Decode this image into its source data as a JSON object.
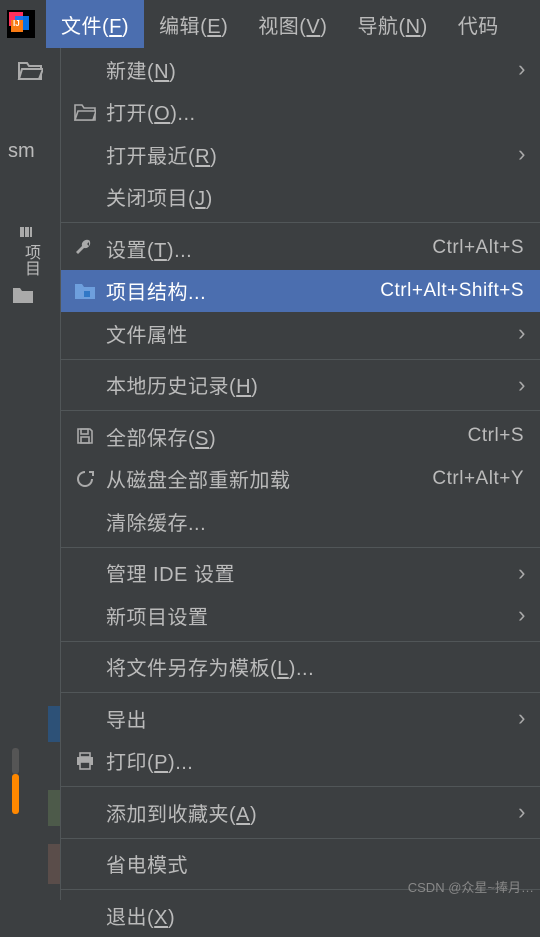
{
  "menubar": {
    "items": [
      {
        "label": "文件",
        "key": "F",
        "active": true
      },
      {
        "label": "编辑",
        "key": "E"
      },
      {
        "label": "视图",
        "key": "V"
      },
      {
        "label": "导航",
        "key": "N"
      },
      {
        "label": "代码",
        "key": ""
      }
    ]
  },
  "sidebar": {
    "proj_prefix": "sm",
    "vertical_label": "项目"
  },
  "menu": {
    "new": "新建",
    "new_key": "N",
    "open": "打开",
    "open_key": "O",
    "open_suffix": "...",
    "open_recent": "打开最近",
    "open_recent_key": "R",
    "close_project": "关闭项目",
    "close_project_key": "J",
    "settings": "设置",
    "settings_key": "T",
    "settings_suffix": "...",
    "settings_shortcut": "Ctrl+Alt+S",
    "project_structure": "项目结构...",
    "project_structure_shortcut": "Ctrl+Alt+Shift+S",
    "file_properties": "文件属性",
    "local_history": "本地历史记录",
    "local_history_key": "H",
    "save_all": "全部保存",
    "save_all_key": "S",
    "save_all_shortcut": "Ctrl+S",
    "reload_from_disk": "从磁盘全部重新加载",
    "reload_shortcut": "Ctrl+Alt+Y",
    "invalidate_caches": "清除缓存...",
    "manage_ide_settings": "管理 IDE 设置",
    "new_project_settings": "新项目设置",
    "save_as_template": "将文件另存为模板",
    "save_as_template_key": "L",
    "save_as_template_suffix": "...",
    "export": "导出",
    "print": "打印",
    "print_key": "P",
    "print_suffix": "...",
    "add_to_favorites": "添加到收藏夹",
    "add_to_favorites_key": "A",
    "power_save_mode": "省电模式",
    "exit": "退出",
    "exit_key": "X"
  },
  "watermark": "CSDN @众星~捧月…"
}
